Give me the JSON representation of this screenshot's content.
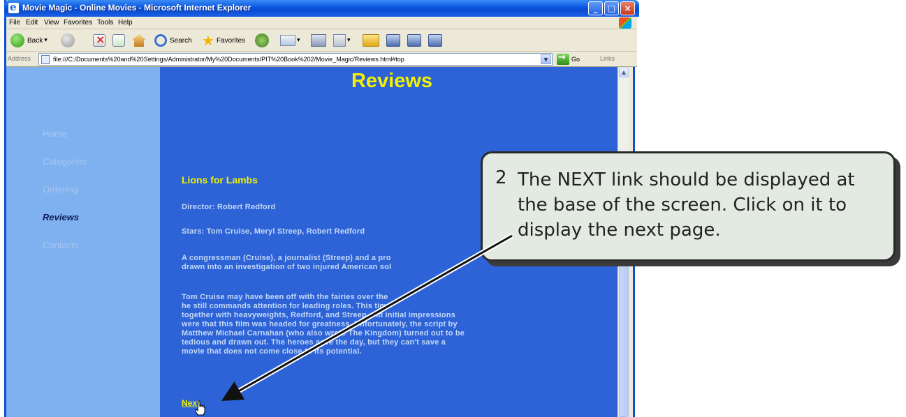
{
  "window": {
    "title": "Movie Magic - Online Movies - Microsoft Internet Explorer",
    "menu": [
      "File",
      "Edit",
      "View",
      "Favorites",
      "Tools",
      "Help"
    ],
    "toolbar": {
      "back_label": "Back",
      "search_label": "Search",
      "favorites_label": "Favorites"
    },
    "address": {
      "label": "Address",
      "url": "file:///C:/Documents%20and%20Settings/Administrator/My%20Documents/PIT%20Book%202/Movie_Magic/Reviews.html#top",
      "go_label": "Go",
      "links_label": "Links"
    }
  },
  "page": {
    "nav": [
      "Home",
      "Categories",
      "Ordering",
      "Reviews",
      "Contacts"
    ],
    "active_nav": "Reviews",
    "title": "Reviews",
    "film_title": "Lions for Lambs",
    "director": "Director: Robert Redford",
    "stars": "Stars: Tom Cruise, Meryl Streep, Robert Redford",
    "synopsis_line1": "A congressman (Cruise), a journalist (Streep) and a pro",
    "synopsis_line2": "drawn into an investigation of two injured American sol",
    "review_lines": [
      "Tom Cruise may have been off with the fairies over the",
      "he still commands attention for leading roles. This time",
      "together with heavyweights, Redford, and Streep and initial impressions",
      "were that this film was headed for greatness. Unfortunately, the script by",
      "Matthew Michael Carnahan (who also wrote The Kingdom) turned out to be",
      "tedious and drawn out. The heroes save the day, but they can't save a",
      "movie that does not come close to its potential."
    ],
    "next_label": "Next"
  },
  "callout": {
    "number": "2",
    "text": "The NEXT link should be displayed at the base of the screen.  Click on it to display the next page."
  },
  "colors": {
    "page_bg": "#2d63d6",
    "nav_bg": "#7fb0f0",
    "heading": "#f2f200",
    "body_text": "#c4d8f8"
  }
}
